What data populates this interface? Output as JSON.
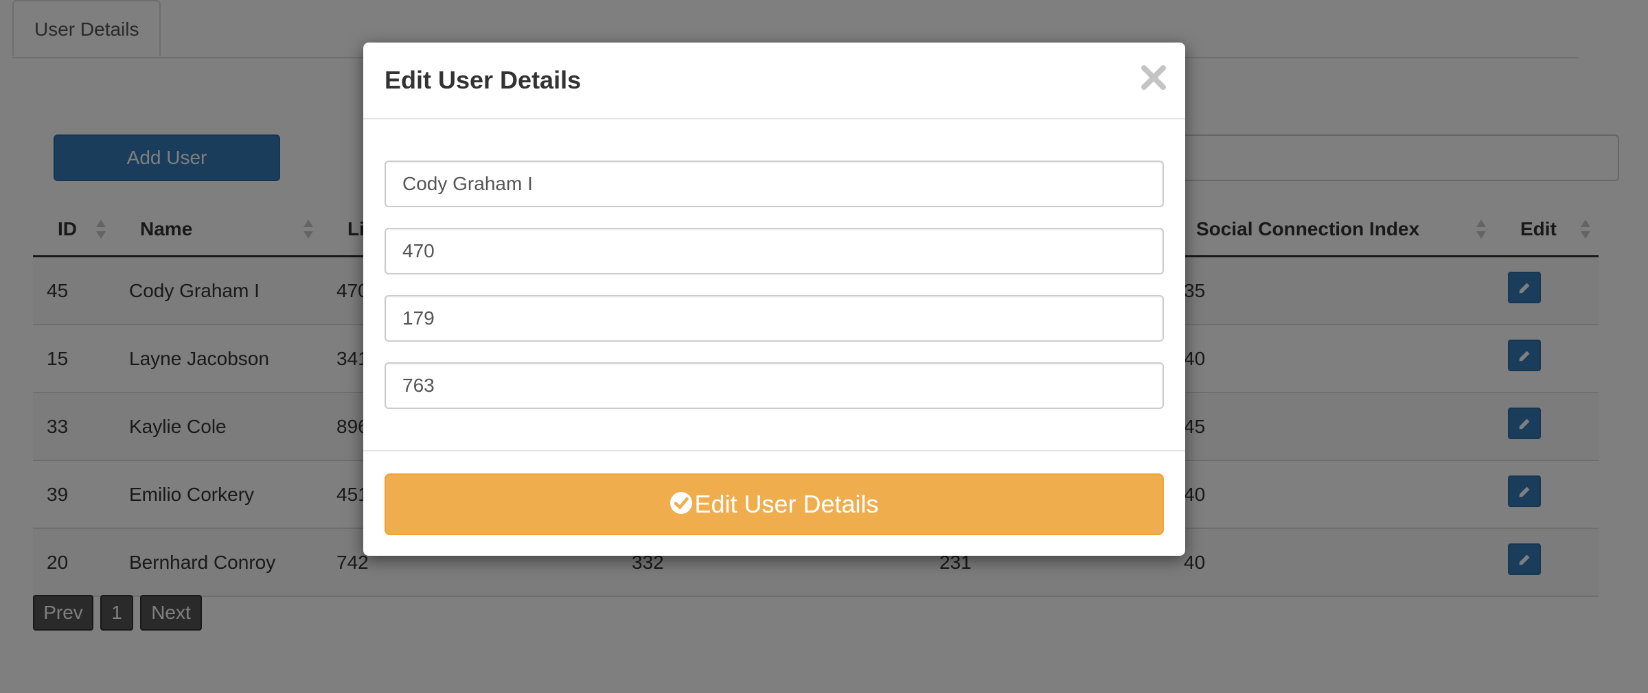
{
  "tabs": [
    {
      "label": "User Details"
    }
  ],
  "toolbar": {
    "add_user_label": "Add User"
  },
  "table": {
    "headers": {
      "id": "ID",
      "name": "Name",
      "col3": "Li",
      "social": "Social Connection Index",
      "edit": "Edit"
    },
    "rows": [
      {
        "id": "45",
        "name": "Cody Graham I",
        "col3": "470",
        "col4": "179",
        "col5": "763",
        "social": "35"
      },
      {
        "id": "15",
        "name": "Layne Jacobson",
        "col3": "341",
        "col4": "",
        "col5": "",
        "social": "40"
      },
      {
        "id": "33",
        "name": "Kaylie Cole",
        "col3": "896",
        "col4": "",
        "col5": "",
        "social": "45"
      },
      {
        "id": "39",
        "name": "Emilio Corkery",
        "col3": "451",
        "col4": "",
        "col5": "",
        "social": "40"
      },
      {
        "id": "20",
        "name": "Bernhard Conroy",
        "col3": "742",
        "col4": "332",
        "col5": "231",
        "social": "40"
      }
    ]
  },
  "pagination": {
    "prev": "Prev",
    "page": "1",
    "next": "Next"
  },
  "modal": {
    "title": "Edit User Details",
    "close_icon": "close-icon",
    "fields": [
      {
        "value": "Cody Graham I"
      },
      {
        "value": "470"
      },
      {
        "value": "179"
      },
      {
        "value": "763"
      }
    ],
    "submit_label": "Edit User Details",
    "submit_icon": "check-circle-icon"
  },
  "colors": {
    "primary": "#337ab7",
    "warning": "#f0ad4e",
    "pager": "#555555"
  }
}
